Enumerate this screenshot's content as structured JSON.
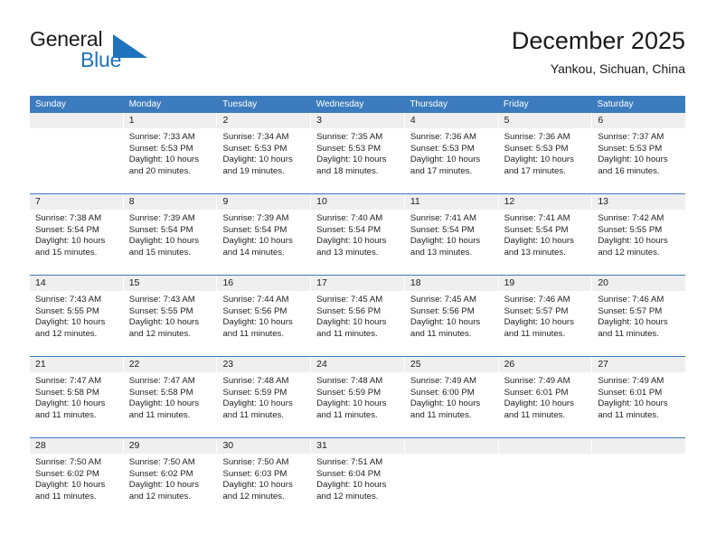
{
  "brand": {
    "name_top": "General",
    "name_bottom": "Blue",
    "triangle_color": "#1f72bd",
    "text_color_top": "#1c1c1c",
    "text_color_bottom": "#1f72bd"
  },
  "header": {
    "title": "December 2025",
    "subtitle": "Yankou, Sichuan, China"
  },
  "theme": {
    "header_band": "#3c7cbe",
    "daynum_band": "#efefef",
    "grid_line": "#3c7cbe",
    "page_background": "#ffffff",
    "text": "#1a1a1a"
  },
  "calendar": {
    "weekdays": [
      "Sunday",
      "Monday",
      "Tuesday",
      "Wednesday",
      "Thursday",
      "Friday",
      "Saturday"
    ],
    "weeks": [
      [
        {
          "day": "",
          "lines": []
        },
        {
          "day": "1",
          "lines": [
            "Sunrise: 7:33 AM",
            "Sunset: 5:53 PM",
            "Daylight: 10 hours",
            "and 20 minutes."
          ]
        },
        {
          "day": "2",
          "lines": [
            "Sunrise: 7:34 AM",
            "Sunset: 5:53 PM",
            "Daylight: 10 hours",
            "and 19 minutes."
          ]
        },
        {
          "day": "3",
          "lines": [
            "Sunrise: 7:35 AM",
            "Sunset: 5:53 PM",
            "Daylight: 10 hours",
            "and 18 minutes."
          ]
        },
        {
          "day": "4",
          "lines": [
            "Sunrise: 7:36 AM",
            "Sunset: 5:53 PM",
            "Daylight: 10 hours",
            "and 17 minutes."
          ]
        },
        {
          "day": "5",
          "lines": [
            "Sunrise: 7:36 AM",
            "Sunset: 5:53 PM",
            "Daylight: 10 hours",
            "and 17 minutes."
          ]
        },
        {
          "day": "6",
          "lines": [
            "Sunrise: 7:37 AM",
            "Sunset: 5:53 PM",
            "Daylight: 10 hours",
            "and 16 minutes."
          ]
        }
      ],
      [
        {
          "day": "7",
          "lines": [
            "Sunrise: 7:38 AM",
            "Sunset: 5:54 PM",
            "Daylight: 10 hours",
            "and 15 minutes."
          ]
        },
        {
          "day": "8",
          "lines": [
            "Sunrise: 7:39 AM",
            "Sunset: 5:54 PM",
            "Daylight: 10 hours",
            "and 15 minutes."
          ]
        },
        {
          "day": "9",
          "lines": [
            "Sunrise: 7:39 AM",
            "Sunset: 5:54 PM",
            "Daylight: 10 hours",
            "and 14 minutes."
          ]
        },
        {
          "day": "10",
          "lines": [
            "Sunrise: 7:40 AM",
            "Sunset: 5:54 PM",
            "Daylight: 10 hours",
            "and 13 minutes."
          ]
        },
        {
          "day": "11",
          "lines": [
            "Sunrise: 7:41 AM",
            "Sunset: 5:54 PM",
            "Daylight: 10 hours",
            "and 13 minutes."
          ]
        },
        {
          "day": "12",
          "lines": [
            "Sunrise: 7:41 AM",
            "Sunset: 5:54 PM",
            "Daylight: 10 hours",
            "and 13 minutes."
          ]
        },
        {
          "day": "13",
          "lines": [
            "Sunrise: 7:42 AM",
            "Sunset: 5:55 PM",
            "Daylight: 10 hours",
            "and 12 minutes."
          ]
        }
      ],
      [
        {
          "day": "14",
          "lines": [
            "Sunrise: 7:43 AM",
            "Sunset: 5:55 PM",
            "Daylight: 10 hours",
            "and 12 minutes."
          ]
        },
        {
          "day": "15",
          "lines": [
            "Sunrise: 7:43 AM",
            "Sunset: 5:55 PM",
            "Daylight: 10 hours",
            "and 12 minutes."
          ]
        },
        {
          "day": "16",
          "lines": [
            "Sunrise: 7:44 AM",
            "Sunset: 5:56 PM",
            "Daylight: 10 hours",
            "and 11 minutes."
          ]
        },
        {
          "day": "17",
          "lines": [
            "Sunrise: 7:45 AM",
            "Sunset: 5:56 PM",
            "Daylight: 10 hours",
            "and 11 minutes."
          ]
        },
        {
          "day": "18",
          "lines": [
            "Sunrise: 7:45 AM",
            "Sunset: 5:56 PM",
            "Daylight: 10 hours",
            "and 11 minutes."
          ]
        },
        {
          "day": "19",
          "lines": [
            "Sunrise: 7:46 AM",
            "Sunset: 5:57 PM",
            "Daylight: 10 hours",
            "and 11 minutes."
          ]
        },
        {
          "day": "20",
          "lines": [
            "Sunrise: 7:46 AM",
            "Sunset: 5:57 PM",
            "Daylight: 10 hours",
            "and 11 minutes."
          ]
        }
      ],
      [
        {
          "day": "21",
          "lines": [
            "Sunrise: 7:47 AM",
            "Sunset: 5:58 PM",
            "Daylight: 10 hours",
            "and 11 minutes."
          ]
        },
        {
          "day": "22",
          "lines": [
            "Sunrise: 7:47 AM",
            "Sunset: 5:58 PM",
            "Daylight: 10 hours",
            "and 11 minutes."
          ]
        },
        {
          "day": "23",
          "lines": [
            "Sunrise: 7:48 AM",
            "Sunset: 5:59 PM",
            "Daylight: 10 hours",
            "and 11 minutes."
          ]
        },
        {
          "day": "24",
          "lines": [
            "Sunrise: 7:48 AM",
            "Sunset: 5:59 PM",
            "Daylight: 10 hours",
            "and 11 minutes."
          ]
        },
        {
          "day": "25",
          "lines": [
            "Sunrise: 7:49 AM",
            "Sunset: 6:00 PM",
            "Daylight: 10 hours",
            "and 11 minutes."
          ]
        },
        {
          "day": "26",
          "lines": [
            "Sunrise: 7:49 AM",
            "Sunset: 6:01 PM",
            "Daylight: 10 hours",
            "and 11 minutes."
          ]
        },
        {
          "day": "27",
          "lines": [
            "Sunrise: 7:49 AM",
            "Sunset: 6:01 PM",
            "Daylight: 10 hours",
            "and 11 minutes."
          ]
        }
      ],
      [
        {
          "day": "28",
          "lines": [
            "Sunrise: 7:50 AM",
            "Sunset: 6:02 PM",
            "Daylight: 10 hours",
            "and 11 minutes."
          ]
        },
        {
          "day": "29",
          "lines": [
            "Sunrise: 7:50 AM",
            "Sunset: 6:02 PM",
            "Daylight: 10 hours",
            "and 12 minutes."
          ]
        },
        {
          "day": "30",
          "lines": [
            "Sunrise: 7:50 AM",
            "Sunset: 6:03 PM",
            "Daylight: 10 hours",
            "and 12 minutes."
          ]
        },
        {
          "day": "31",
          "lines": [
            "Sunrise: 7:51 AM",
            "Sunset: 6:04 PM",
            "Daylight: 10 hours",
            "and 12 minutes."
          ]
        },
        {
          "day": "",
          "lines": []
        },
        {
          "day": "",
          "lines": []
        },
        {
          "day": "",
          "lines": []
        }
      ]
    ]
  }
}
